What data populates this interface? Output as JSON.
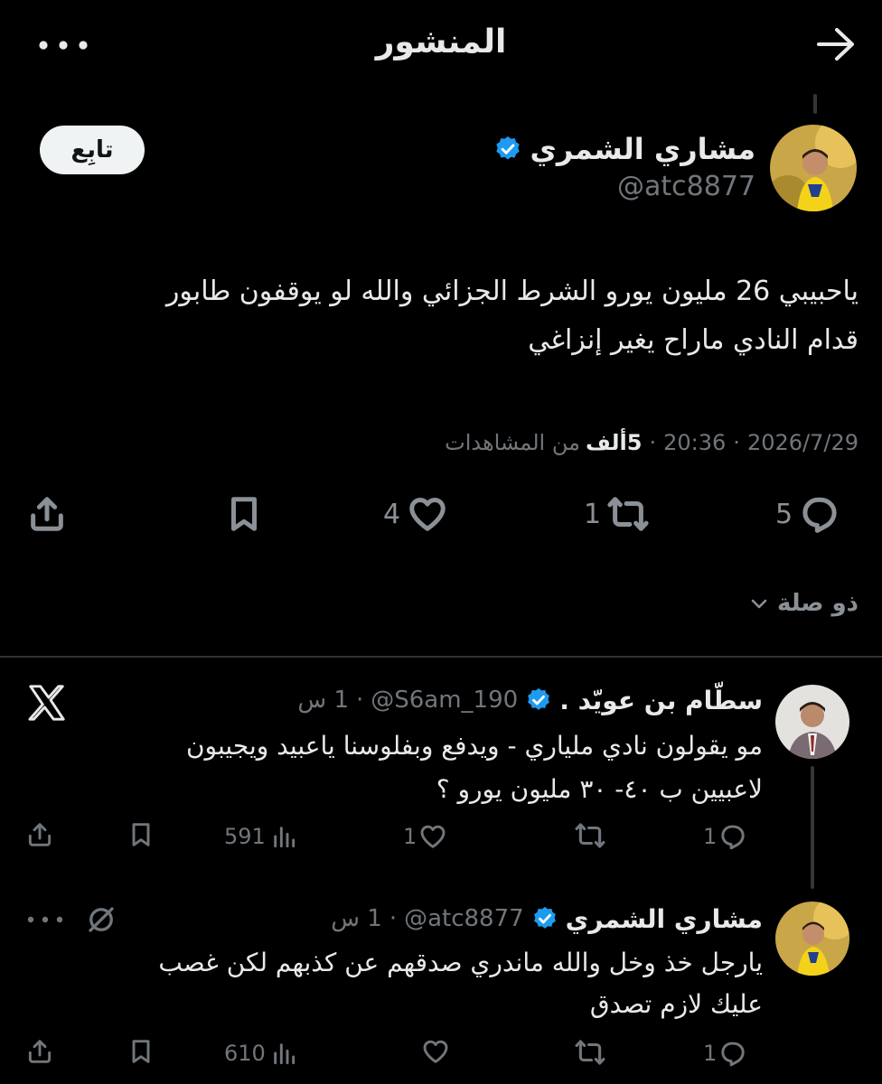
{
  "header": {
    "title": "المنشور"
  },
  "post": {
    "author_name": "مشاري الشمري",
    "author_handle": "@atc8877",
    "follow_label": "تابِع",
    "text_line1": "ياحبيبي 26 مليون يورو الشرط الجزائي والله لو يوقفون طابور",
    "text_line2": "قدام النادي ماراح يغير إنزاغي",
    "date": "2026/7/29",
    "time": "20:36",
    "views_count": "5ألف",
    "views_label": "من المشاهدات",
    "replies": "5",
    "reposts": "1",
    "likes": "4",
    "relevance_label": "ذو صلة"
  },
  "replies": [
    {
      "name": "سطّام بن عويّد .",
      "handle": "@S6am_190",
      "time": "1 س",
      "line1": "مو يقولون نادي ملياري - ويدفع وبفلوسنا ياعبيد ويجيبون",
      "line2": "لاعبيين ب ٤٠- ٣٠ مليون يورو ؟",
      "replies": "1",
      "reposts": "",
      "likes": "1",
      "views": "591",
      "badge_icon": "x-logo-icon"
    },
    {
      "name": "مشاري الشمري",
      "handle": "@atc8877",
      "time": "1 س",
      "line1": "يارجل خذ وخل والله ماندري صدقهم عن كذبهم لكن غصب",
      "line2": "عليك لازم تصدق",
      "replies": "1",
      "reposts": "",
      "likes": "",
      "views": "610",
      "badge_icon": "grok-icon"
    }
  ],
  "colors": {
    "background": "#000000",
    "text": "#e7e9ea",
    "muted": "#71767b",
    "verified": "#1d9bf0",
    "divider": "#2f3336"
  }
}
